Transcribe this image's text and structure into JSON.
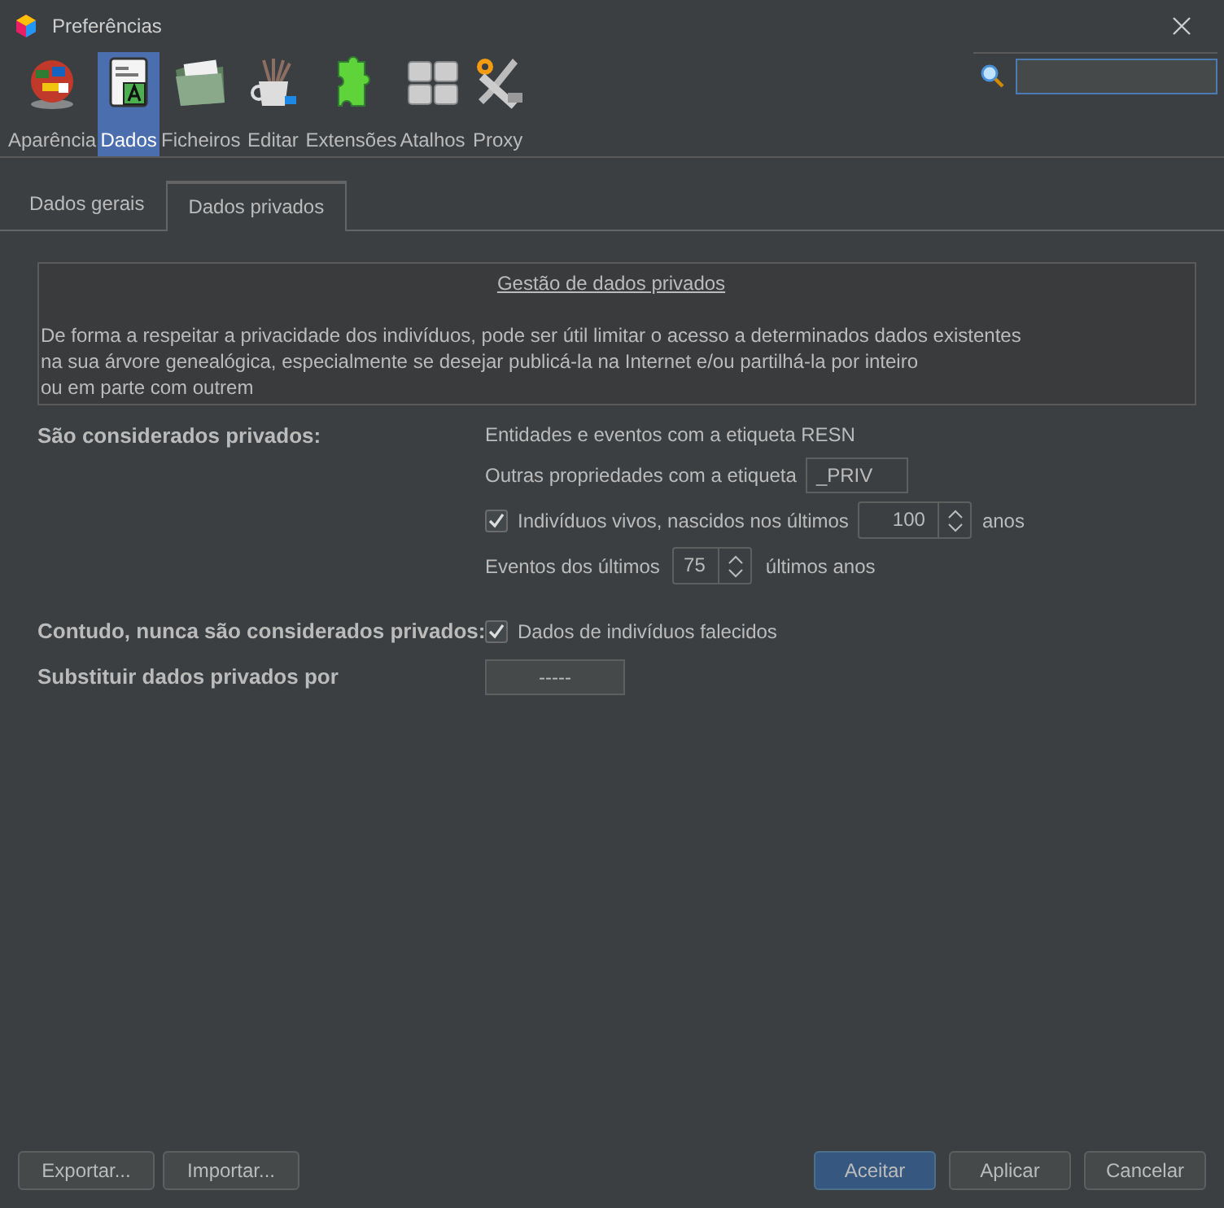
{
  "window": {
    "title": "Preferências"
  },
  "toolbar": [
    {
      "label": "Aparência",
      "kind": "globe",
      "selected": false
    },
    {
      "label": "Dados",
      "kind": "document",
      "selected": true
    },
    {
      "label": "Ficheiros",
      "kind": "folder",
      "selected": false
    },
    {
      "label": "Editar",
      "kind": "brushes",
      "selected": false
    },
    {
      "label": "Extensões",
      "kind": "puzzle",
      "selected": false
    },
    {
      "label": "Atalhos",
      "kind": "keys",
      "selected": false
    },
    {
      "label": "Proxy",
      "kind": "wrench",
      "selected": false
    }
  ],
  "tabs": [
    {
      "label": "Dados gerais",
      "selected": false
    },
    {
      "label": "Dados privados",
      "selected": true
    }
  ],
  "info": {
    "title": "Gestão de dados privados",
    "lines": [
      "De forma a respeitar a privacidade dos indivíduos, pode ser útil limitar o acesso a determinados dados existentes",
      "na sua árvore genealógica, especialmente se desejar publicá-la na Internet e/ou partilhá-la por inteiro",
      "ou em parte com outrem"
    ]
  },
  "private": {
    "label": "São considerados privados:",
    "resn": "Entidades e eventos com a etiqueta RESN",
    "tag_label": "Outras propriedades com a etiqueta",
    "tag_value": "_PRIV",
    "living": {
      "checked": true,
      "label": "Indivíduos vivos, nascidos nos últimos",
      "value": "100",
      "unit": "anos"
    },
    "events": {
      "label": "Eventos dos últimos",
      "value": "75",
      "unit": "últimos anos"
    }
  },
  "never": {
    "label": "Contudo, nunca são considerados privados:",
    "deceased": {
      "checked": true,
      "label": "Dados de indivíduos falecidos"
    }
  },
  "replace": {
    "label": "Substituir dados privados por",
    "value": "-----"
  },
  "footer_left": [
    "Exportar...",
    "Importar..."
  ],
  "footer_right": [
    {
      "label": "Aceitar",
      "selected": true
    },
    {
      "label": "Aplicar",
      "selected": false
    },
    {
      "label": "Cancelar",
      "selected": false
    }
  ]
}
